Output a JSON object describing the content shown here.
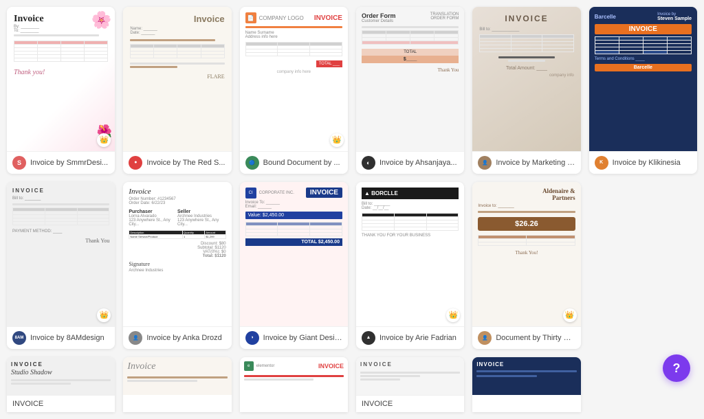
{
  "cards": [
    {
      "id": 1,
      "label": "Invoice by SmmrDesi...",
      "avatar_color": "#e06060",
      "avatar_text": "S",
      "has_crown": true,
      "thumb_style": "floral"
    },
    {
      "id": 2,
      "label": "Invoice by The Red S...",
      "avatar_color": "#e04040",
      "avatar_text": "",
      "has_crown": false,
      "thumb_style": "redstripe"
    },
    {
      "id": 3,
      "label": "Bound Document by ...",
      "avatar_color": "#3a8a5a",
      "avatar_text": "",
      "has_crown": true,
      "thumb_style": "bound"
    },
    {
      "id": 4,
      "label": "Invoice by Ahsanjaya...",
      "avatar_color": "#303030",
      "avatar_text": "",
      "has_crown": false,
      "thumb_style": "orderform"
    },
    {
      "id": 5,
      "label": "Invoice by Marketing Te...",
      "avatar_color": "#a08060",
      "avatar_text": "",
      "has_crown": false,
      "thumb_style": "marketing"
    },
    {
      "id": 6,
      "label": "Invoice by Klikinesia",
      "avatar_color": "#e08030",
      "avatar_text": "",
      "has_crown": false,
      "thumb_style": "klikinesia"
    },
    {
      "id": 7,
      "label": "Invoice by 8AMdesign",
      "avatar_color": "#304880",
      "avatar_text": "8AM",
      "has_crown": true,
      "thumb_style": "eightam"
    },
    {
      "id": 8,
      "label": "Invoice by Anka Drozd",
      "avatar_color": "#606060",
      "avatar_text": "",
      "has_crown": false,
      "thumb_style": "ankaform"
    },
    {
      "id": 9,
      "label": "Invoice by Giant Design",
      "avatar_color": "#2040a0",
      "avatar_text": "",
      "has_crown": false,
      "thumb_style": "giantdesign"
    },
    {
      "id": 10,
      "label": "Invoice by Arie Fadrian",
      "avatar_color": "#303030",
      "avatar_text": "",
      "has_crown": true,
      "thumb_style": "borcelle2"
    },
    {
      "id": 11,
      "label": "Document by Thirty One ...",
      "avatar_color": "#c09060",
      "avatar_text": "",
      "has_crown": true,
      "thumb_style": "thirtyone"
    },
    {
      "id": 12,
      "label": "INVOICE",
      "avatar_color": "#404040",
      "avatar_text": "",
      "has_crown": false,
      "thumb_style": "partial1",
      "partial": true
    },
    {
      "id": 13,
      "label": "",
      "avatar_color": "#888",
      "avatar_text": "",
      "has_crown": false,
      "thumb_style": "partial2",
      "partial": true
    },
    {
      "id": 14,
      "label": "",
      "avatar_color": "#3a8a5a",
      "avatar_text": "",
      "has_crown": false,
      "thumb_style": "partial3",
      "partial": true
    },
    {
      "id": 15,
      "label": "INVOICE",
      "avatar_color": "#606060",
      "avatar_text": "",
      "has_crown": false,
      "thumb_style": "partial4",
      "partial": true
    },
    {
      "id": 16,
      "label": "",
      "avatar_color": "#1a2e5a",
      "avatar_text": "",
      "has_crown": false,
      "thumb_style": "partial5",
      "partial": true
    }
  ],
  "help_button": "?"
}
